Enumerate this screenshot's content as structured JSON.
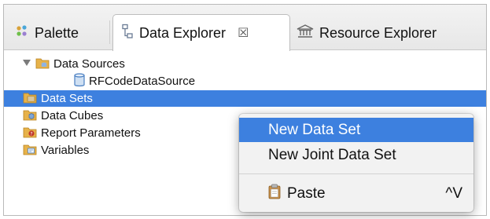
{
  "tabs": [
    {
      "label": "Palette",
      "icon": "palette-icon",
      "active": false
    },
    {
      "label": "Data Explorer",
      "icon": "data-explorer-icon",
      "active": true,
      "close_symbol": "☒"
    },
    {
      "label": "Resource Explorer",
      "icon": "resource-explorer-icon",
      "active": false
    }
  ],
  "tree": {
    "items": [
      {
        "label": "Data Sources",
        "icon": "data-sources-folder-icon",
        "expanded": true,
        "selected": false
      },
      {
        "label": "RFCodeDataSource",
        "icon": "database-cylinder-icon",
        "selected": false
      },
      {
        "label": "Data Sets",
        "icon": "data-sets-folder-icon",
        "selected": true
      },
      {
        "label": "Data Cubes",
        "icon": "data-cubes-folder-icon",
        "selected": false
      },
      {
        "label": "Report Parameters",
        "icon": "report-parameters-folder-icon",
        "selected": false
      },
      {
        "label": "Variables",
        "icon": "variables-folder-icon",
        "selected": false
      }
    ]
  },
  "context_menu": {
    "items": [
      {
        "label": "New Data Set",
        "highlighted": true
      },
      {
        "label": "New Joint Data Set",
        "highlighted": false
      },
      {
        "label": "Paste",
        "icon": "paste-clipboard-icon",
        "shortcut": "^V",
        "highlighted": false
      }
    ]
  },
  "colors": {
    "selection": "#3d80df",
    "folder": "#e7b24a",
    "menu_background": "#f2f2f2"
  }
}
